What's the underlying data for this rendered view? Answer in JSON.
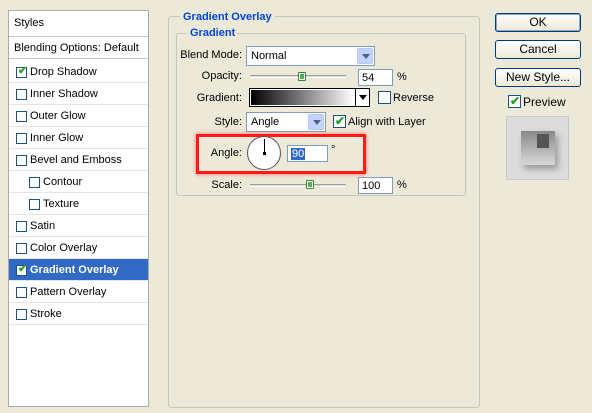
{
  "sidebar": {
    "header": "Styles",
    "blending_options": "Blending Options: Default",
    "items": [
      {
        "label": "Drop Shadow",
        "checked": true
      },
      {
        "label": "Inner Shadow",
        "checked": false
      },
      {
        "label": "Outer Glow",
        "checked": false
      },
      {
        "label": "Inner Glow",
        "checked": false
      },
      {
        "label": "Bevel and Emboss",
        "checked": false
      },
      {
        "label": "Contour",
        "checked": false
      },
      {
        "label": "Texture",
        "checked": false
      },
      {
        "label": "Satin",
        "checked": false
      },
      {
        "label": "Color Overlay",
        "checked": false
      },
      {
        "label": "Gradient Overlay",
        "checked": true,
        "selected": true
      },
      {
        "label": "Pattern Overlay",
        "checked": false
      },
      {
        "label": "Stroke",
        "checked": false
      }
    ]
  },
  "panel": {
    "title": "Gradient Overlay",
    "section": "Gradient",
    "blend_mode_label": "Blend Mode:",
    "blend_mode_value": "Normal",
    "opacity_label": "Opacity:",
    "opacity_value": "54",
    "opacity_unit": "%",
    "opacity_level": 0.54,
    "gradient_label": "Gradient:",
    "reverse_label": "Reverse",
    "reverse_checked": false,
    "style_label": "Style:",
    "style_value": "Angle",
    "align_label": "Align with Layer",
    "align_checked": true,
    "angle_label": "Angle:",
    "angle_value": "90",
    "angle_unit": "°",
    "scale_label": "Scale:",
    "scale_value": "100",
    "scale_unit": "%",
    "scale_level": 0.63
  },
  "buttons": {
    "ok": "OK",
    "cancel": "Cancel",
    "new_style": "New Style...",
    "preview_label": "Preview",
    "preview_checked": true
  },
  "colors": {
    "selection": "#316ac5",
    "group_title": "#0046d5",
    "highlight": "#ff1a1a"
  }
}
